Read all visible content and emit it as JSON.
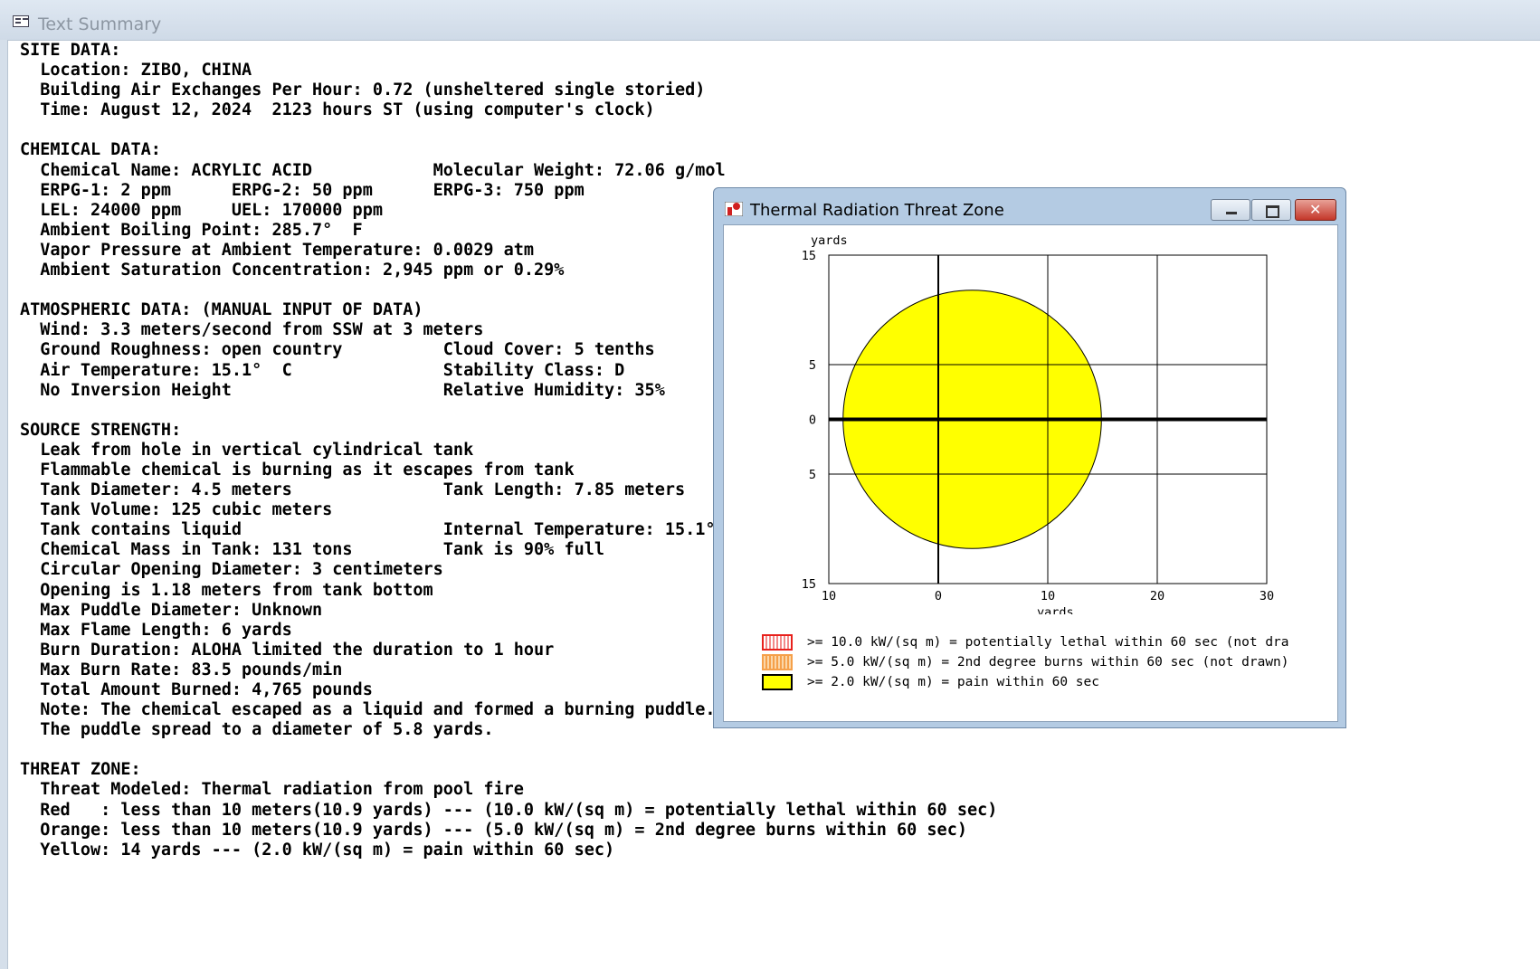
{
  "main_window": {
    "title": "Text Summary",
    "summary_text": "SITE DATA:\n  Location: ZIBO, CHINA\n  Building Air Exchanges Per Hour: 0.72 (unsheltered single storied)\n  Time: August 12, 2024  2123 hours ST (using computer's clock)\n\nCHEMICAL DATA:\n  Chemical Name: ACRYLIC ACID            Molecular Weight: 72.06 g/mol\n  ERPG-1: 2 ppm      ERPG-2: 50 ppm      ERPG-3: 750 ppm\n  LEL: 24000 ppm     UEL: 170000 ppm\n  Ambient Boiling Point: 285.7°  F\n  Vapor Pressure at Ambient Temperature: 0.0029 atm\n  Ambient Saturation Concentration: 2,945 ppm or 0.29%\n\nATMOSPHERIC DATA: (MANUAL INPUT OF DATA)\n  Wind: 3.3 meters/second from SSW at 3 meters\n  Ground Roughness: open country          Cloud Cover: 5 tenths\n  Air Temperature: 15.1°  C               Stability Class: D\n  No Inversion Height                     Relative Humidity: 35%\n\nSOURCE STRENGTH:\n  Leak from hole in vertical cylindrical tank\n  Flammable chemical is burning as it escapes from tank\n  Tank Diameter: 4.5 meters               Tank Length: 7.85 meters\n  Tank Volume: 125 cubic meters\n  Tank contains liquid                    Internal Temperature: 15.1°\n  Chemical Mass in Tank: 131 tons         Tank is 90% full\n  Circular Opening Diameter: 3 centimeters\n  Opening is 1.18 meters from tank bottom\n  Max Puddle Diameter: Unknown\n  Max Flame Length: 6 yards\n  Burn Duration: ALOHA limited the duration to 1 hour\n  Max Burn Rate: 83.5 pounds/min\n  Total Amount Burned: 4,765 pounds\n  Note: The chemical escaped as a liquid and formed a burning puddle.\n  The puddle spread to a diameter of 5.8 yards.\n\nTHREAT ZONE:\n  Threat Modeled: Thermal radiation from pool fire\n  Red   : less than 10 meters(10.9 yards) --- (10.0 kW/(sq m) = potentially lethal within 60 sec)\n  Orange: less than 10 meters(10.9 yards) --- (5.0 kW/(sq m) = 2nd degree burns within 60 sec)\n  Yellow: 14 yards --- (2.0 kW/(sq m) = pain within 60 sec)"
  },
  "threat_window": {
    "title": "Thermal Radiation Threat Zone",
    "legend": [
      {
        "text": ">= 10.0 kW/(sq m) = potentially lethal within 60 sec (not dra",
        "color": "#e8211c",
        "fill": "#ffffff"
      },
      {
        "text": ">= 5.0 kW/(sq m) = 2nd degree burns within 60 sec (not drawn)",
        "color": "#f5a04a",
        "fill": "#f5a04a"
      },
      {
        "text": ">= 2.0 kW/(sq m) = pain within 60 sec",
        "color": "#000000",
        "fill": "#ffff00"
      }
    ]
  },
  "chart_data": {
    "type": "area",
    "title": "",
    "xlabel": "yards",
    "ylabel": "yards",
    "xlim": [
      -10,
      30
    ],
    "ylim": [
      -15,
      15
    ],
    "x_ticks": [
      "10",
      "0",
      "10",
      "20",
      "30"
    ],
    "y_ticks": [
      "15",
      "5",
      "0",
      "5",
      "15"
    ],
    "grid": true,
    "series": [
      {
        "name": ">= 2.0 kW/(sq m) = pain within 60 sec",
        "color": "#ffff00",
        "shape": "circle",
        "center": [
          3.1,
          0
        ],
        "radius": 11.8
      }
    ]
  }
}
